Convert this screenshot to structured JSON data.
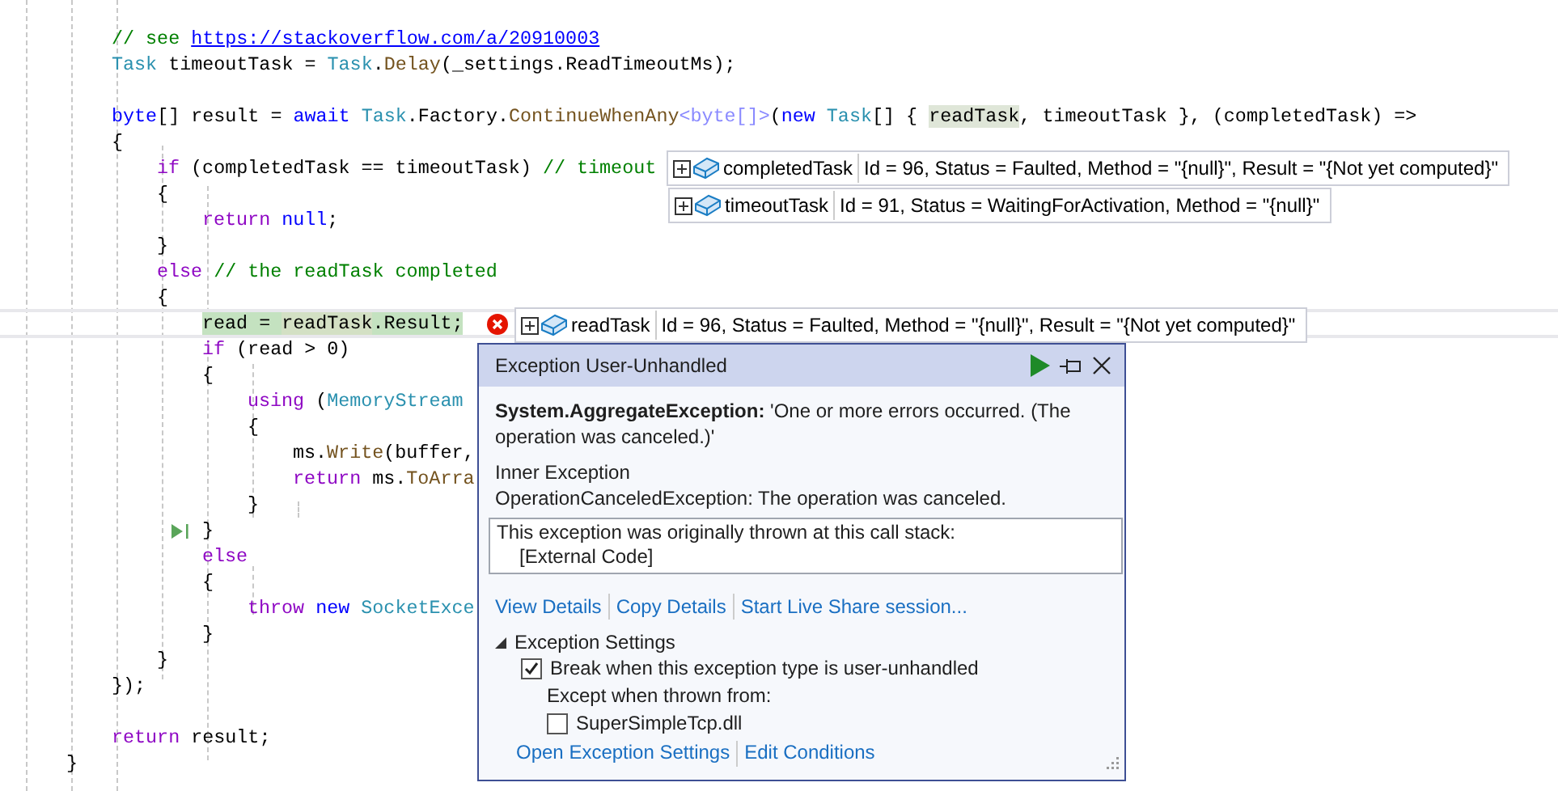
{
  "code": {
    "lines": [
      {
        "kind": "code",
        "tokens": [
          {
            "text": "// see ",
            "kind": "comment"
          },
          {
            "text": "https://stackoverflow.com/a/20910003",
            "kind": "link"
          }
        ]
      },
      {
        "kind": "code",
        "tokens": [
          {
            "text": "Task",
            "kind": "type"
          },
          {
            "text": " timeoutTask = ",
            "kind": "plain"
          },
          {
            "text": "Task",
            "kind": "type"
          },
          {
            "text": ".",
            "kind": "plain"
          },
          {
            "text": "Delay",
            "kind": "method"
          },
          {
            "text": "(_settings.ReadTimeoutMs);",
            "kind": "plain"
          }
        ]
      },
      {
        "kind": "blank"
      },
      {
        "kind": "code",
        "tokens": [
          {
            "text": "byte",
            "kind": "keyword"
          },
          {
            "text": "[] result = ",
            "kind": "plain"
          },
          {
            "text": "await ",
            "kind": "keyword"
          },
          {
            "text": "Task",
            "kind": "type"
          },
          {
            "text": ".Factory.",
            "kind": "plain"
          },
          {
            "text": "ContinueWhenAny",
            "kind": "method"
          },
          {
            "text": "<byte[]>",
            "kind": "faded"
          },
          {
            "text": "(",
            "kind": "plain"
          },
          {
            "text": "new ",
            "kind": "keyword"
          },
          {
            "text": "Task",
            "kind": "type"
          },
          {
            "text": "[] { ",
            "kind": "plain"
          },
          {
            "text": "readTask",
            "kind": "reference"
          },
          {
            "text": ", timeoutTask }, (completedTask) =>",
            "kind": "plain"
          }
        ]
      },
      {
        "kind": "code",
        "tokens": [
          {
            "text": "{",
            "kind": "plain"
          }
        ],
        "children": [
          {
            "kind": "code",
            "tokens": [
              {
                "text": "if",
                "kind": "control"
              },
              {
                "text": " (completedTask == timeoutTask) ",
                "kind": "plain"
              },
              {
                "text": "// timeout",
                "kind": "comment"
              }
            ]
          },
          {
            "kind": "code",
            "tokens": [
              {
                "text": "{",
                "kind": "plain"
              }
            ],
            "children": [
              {
                "kind": "code",
                "tokens": [
                  {
                    "text": "return ",
                    "kind": "control"
                  },
                  {
                    "text": "null",
                    "kind": "keyword"
                  },
                  {
                    "text": ";",
                    "kind": "plain"
                  }
                ]
              }
            ]
          },
          {
            "kind": "code",
            "tokens": [
              {
                "text": "}",
                "kind": "plain"
              }
            ]
          },
          {
            "kind": "code",
            "tokens": [
              {
                "text": "else ",
                "kind": "control"
              },
              {
                "text": "// the readTask completed",
                "kind": "comment"
              }
            ]
          },
          {
            "kind": "code",
            "tokens": [
              {
                "text": "{",
                "kind": "plain"
              }
            ],
            "children": [
              {
                "kind": "code",
                "current": true,
                "error": true,
                "tokens": [
                  {
                    "text": "read = ",
                    "kind": "statement"
                  },
                  {
                    "text": "readTask",
                    "kind": "statement_reference"
                  },
                  {
                    "text": ".Result;",
                    "kind": "statement"
                  }
                ]
              },
              {
                "kind": "code",
                "tokens": [
                  {
                    "text": "if",
                    "kind": "control"
                  },
                  {
                    "text": " (read > 0)",
                    "kind": "plain"
                  }
                ]
              },
              {
                "kind": "code",
                "tokens": [
                  {
                    "text": "{",
                    "kind": "plain"
                  }
                ],
                "children": [
                  {
                    "kind": "code",
                    "tokens": [
                      {
                        "text": "using",
                        "kind": "control"
                      },
                      {
                        "text": " (",
                        "kind": "plain"
                      },
                      {
                        "text": "MemoryStream",
                        "kind": "type"
                      }
                    ]
                  },
                  {
                    "kind": "code",
                    "tokens": [
                      {
                        "text": "{",
                        "kind": "plain"
                      }
                    ],
                    "children": [
                      {
                        "kind": "code",
                        "tokens": [
                          {
                            "text": "ms.",
                            "kind": "plain"
                          },
                          {
                            "text": "Write",
                            "kind": "method"
                          },
                          {
                            "text": "(buffer,",
                            "kind": "plain"
                          }
                        ]
                      },
                      {
                        "kind": "code",
                        "tokens": [
                          {
                            "text": "return",
                            "kind": "control"
                          },
                          {
                            "text": " ms.",
                            "kind": "plain"
                          },
                          {
                            "text": "ToArra",
                            "kind": "method"
                          }
                        ]
                      }
                    ]
                  },
                  {
                    "kind": "code",
                    "tokens": [
                      {
                        "text": "}",
                        "kind": "plain"
                      }
                    ]
                  }
                ]
              },
              {
                "kind": "code",
                "run_to_click": true,
                "tokens": [
                  {
                    "text": "}",
                    "kind": "plain"
                  }
                ]
              },
              {
                "kind": "code",
                "tokens": [
                  {
                    "text": "else",
                    "kind": "control"
                  }
                ]
              },
              {
                "kind": "code",
                "tokens": [
                  {
                    "text": "{",
                    "kind": "plain"
                  }
                ],
                "children": [
                  {
                    "kind": "code",
                    "tokens": [
                      {
                        "text": "throw ",
                        "kind": "control"
                      },
                      {
                        "text": "new ",
                        "kind": "keyword"
                      },
                      {
                        "text": "SocketExce",
                        "kind": "type"
                      }
                    ]
                  }
                ]
              },
              {
                "kind": "code",
                "tokens": [
                  {
                    "text": "}",
                    "kind": "plain"
                  }
                ]
              }
            ]
          },
          {
            "kind": "code",
            "tokens": [
              {
                "text": "}",
                "kind": "plain"
              }
            ]
          }
        ]
      },
      {
        "kind": "code",
        "tokens": [
          {
            "text": "});",
            "kind": "plain"
          }
        ]
      },
      {
        "kind": "blank"
      },
      {
        "kind": "code",
        "tokens": [
          {
            "text": "return",
            "kind": "control"
          },
          {
            "text": " result;",
            "kind": "plain"
          }
        ]
      }
    ],
    "closing_line": {
      "kind": "code",
      "tokens": [
        {
          "text": "}",
          "kind": "plain"
        }
      ]
    }
  },
  "datatips": [
    {
      "name": "completedTask",
      "value": "Id = 96, Status = Faulted, Method = \"{null}\", Result = \"{Not yet computed}\""
    },
    {
      "name": "timeoutTask",
      "value": "Id = 91, Status = WaitingForActivation, Method = \"{null}\""
    },
    {
      "name": "readTask",
      "value": "Id = 96, Status = Faulted, Method = \"{null}\", Result = \"{Not yet computed}\""
    }
  ],
  "exception": {
    "title": "Exception User-Unhandled",
    "message": "**System.AggregateException:** 'One or more errors occurred. (The operation was canceled.)'",
    "inner_heading": "Inner Exception",
    "inner_message": "OperationCanceledException: The operation was canceled.",
    "stack_heading": "This exception was originally thrown at this call stack:",
    "stack_frames": [
      "[External Code]"
    ],
    "links": [
      "View Details",
      "Copy Details",
      "Start Live Share session..."
    ],
    "settings": {
      "heading": "Exception Settings",
      "expanded": true,
      "break_option": {
        "label": "Break when this exception type is user-unhandled",
        "checked": true
      },
      "except_label": "Except when thrown from:",
      "modules": [
        {
          "label": "SuperSimpleTcp.dll",
          "checked": false
        }
      ]
    },
    "footer_links": [
      "Open Exception Settings",
      "Edit Conditions"
    ]
  }
}
